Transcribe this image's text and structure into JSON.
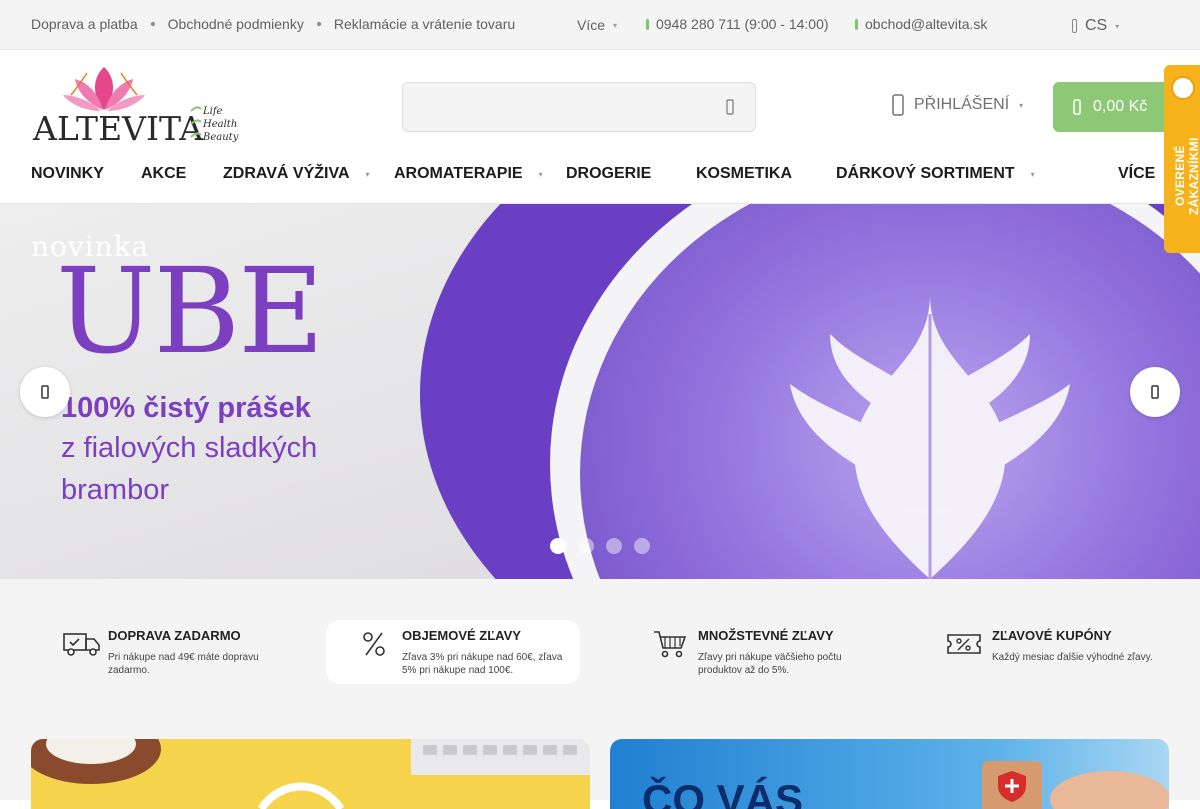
{
  "topbar": {
    "links": [
      "Doprava a platba",
      "Obchodné podmienky",
      "Reklamácie a vrátenie tovaru"
    ],
    "more_label": "Více",
    "phone": "0948 280 711 (9:00 - 14:00)",
    "email": "obchod@altevita.sk",
    "language": "CS"
  },
  "header": {
    "logo_text": "ALTEVITA",
    "logo_tagline": [
      "Life",
      "Health",
      "Beauty"
    ],
    "search_placeholder": "",
    "login_label": "PŘIHLÁŠENÍ",
    "cart_total": "0,00 Kč"
  },
  "badge": {
    "label": "OVERENÉ ZÁKAZNÍKMI"
  },
  "nav": {
    "items": [
      {
        "label": "NOVINKY"
      },
      {
        "label": "AKCE"
      },
      {
        "label": "ZDRAVÁ VÝŽIVA"
      },
      {
        "label": "AROMATERAPIE"
      },
      {
        "label": "DROGERIE"
      },
      {
        "label": "KOSMETIKA"
      },
      {
        "label": "DÁRKOVÝ SORTIMENT"
      },
      {
        "label": "VÍCE"
      }
    ]
  },
  "hero": {
    "tag": "novinka",
    "headline": "UBE",
    "line1": "100% čistý prášek",
    "line2": "z fialových sladkých",
    "line3": "brambor",
    "slide_count": 4,
    "active_slide": 1
  },
  "benefits": [
    {
      "icon": "truck-icon",
      "title": "DOPRAVA ZADARMO",
      "desc": "Pri nákupe nad 49€ máte dopravu zadarmo."
    },
    {
      "icon": "percent-icon",
      "title": "OBJEMOVÉ ZĽAVY",
      "desc": "Zľava 3% pri nákupe nad 60€, zľava 5% pri nákupe nad 100€."
    },
    {
      "icon": "cart-icon",
      "title": "MNOŽSTEVNÉ ZĽAVY",
      "desc": "Zľavy pri nákupe väčšieho počtu produktov až do 5%."
    },
    {
      "icon": "coupon-icon",
      "title": "ZĽAVOVÉ KUPÓNY",
      "desc": "Každý mesiac ďalšie výhodné zľavy."
    }
  ],
  "banners": {
    "right_partial_text": "ČO VÁS"
  },
  "colors": {
    "accent_green": "#8cc876",
    "badge_yellow": "#f5b21b",
    "hero_purple": "#7b3fbf"
  }
}
